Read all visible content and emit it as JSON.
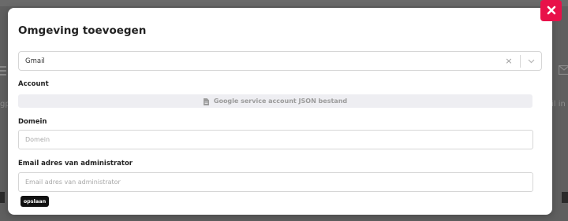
{
  "background": {
    "left_fragment": "gp",
    "right_fragment": "il in"
  },
  "modal": {
    "title": "Omgeving toevoegen",
    "close_icon": "close-icon",
    "provider_select": {
      "value": "Gmail",
      "clear_symbol": "×"
    },
    "account": {
      "label": "Account",
      "upload_text": "Google service account JSON bestand",
      "upload_icon": "document-icon"
    },
    "domain": {
      "label": "Domein",
      "placeholder": "Domein"
    },
    "admin_email": {
      "label": "Email adres van administrator",
      "placeholder": "Email adres van administrator"
    },
    "save_label": "opslaan"
  },
  "colors": {
    "close_button": "#e8114a",
    "save_button": "#111111",
    "overlay": "#5f5f5f"
  }
}
